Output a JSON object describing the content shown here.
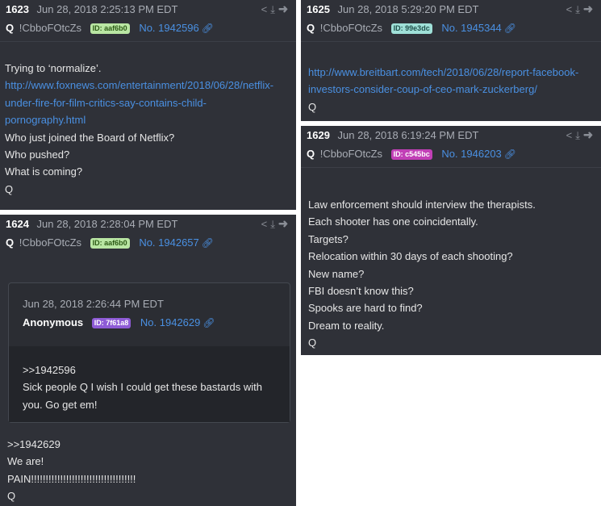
{
  "posts": {
    "p1623": {
      "num": "1623",
      "date": "Jun 28, 2018 2:25:13 PM EDT",
      "author": "Q",
      "trip": "!CbboFOtcZs",
      "id_badge": "ID: aaf6b0",
      "post_no": "No. 1942596",
      "lines": [
        "Trying to ‘normalize’."
      ],
      "link_lines": [
        "http://www.foxnews.com/entertainment/2018/06/28/netflix-",
        "under-fire-for-film-critics-say-contains-child-",
        "pornography.html"
      ],
      "after": [
        "Who just joined the Board of Netflix?",
        "Who pushed?",
        "What is coming?",
        "Q"
      ]
    },
    "p1624": {
      "num": "1624",
      "date": "Jun 28, 2018 2:28:04 PM EDT",
      "author": "Q",
      "trip": "!CbboFOtcZs",
      "id_badge": "ID: aaf6b0",
      "post_no": "No. 1942657",
      "quoted": {
        "date": "Jun 28, 2018 2:26:44 PM EDT",
        "author": "Anonymous",
        "id_badge": "ID: 7f61a8",
        "post_no": "No. 1942629",
        "lines": [
          ">>1942596",
          "Sick people Q I wish I could get these bastards with",
          "you. Go get em!"
        ]
      },
      "lines": [
        ">>1942629",
        "We are!",
        "PAIN!!!!!!!!!!!!!!!!!!!!!!!!!!!!!!!!!!!!",
        "Q"
      ]
    },
    "p1625": {
      "num": "1625",
      "date": "Jun 28, 2018 5:29:20 PM EDT",
      "author": "Q",
      "trip": "!CbboFOtcZs",
      "id_badge": "ID: 99e3dc",
      "post_no": "No. 1945344",
      "link_lines": [
        "http://www.breitbart.com/tech/2018/06/28/report-facebook-",
        "investors-consider-coup-of-ceo-mark-zuckerberg/"
      ],
      "after": [
        "Q"
      ]
    },
    "p1629": {
      "num": "1629",
      "date": "Jun 28, 2018 6:19:24 PM EDT",
      "author": "Q",
      "trip": "!CbboFOtcZs",
      "id_badge": "ID: c545bc",
      "post_no": "No. 1946203",
      "lines": [
        "Law enforcement should interview the therapists.",
        "Each shooter has one coincidentally.",
        "Targets?",
        "Relocation within 30 days of each shooting?",
        "New name?",
        "FBI doesn’t know this?",
        "Spooks are hard to find?",
        "Dream to reality.",
        "Q"
      ]
    }
  },
  "icons": [
    "share-icon",
    "download-icon",
    "reply-arrow-icon",
    "link-icon"
  ],
  "colors": {
    "card": "#2f3138",
    "link": "#4a90e2",
    "id_green": "#b9e6a3",
    "id_teal": "#9fe0d8",
    "id_purple": "#8e5bd6",
    "id_magenta": "#c13fb6"
  }
}
